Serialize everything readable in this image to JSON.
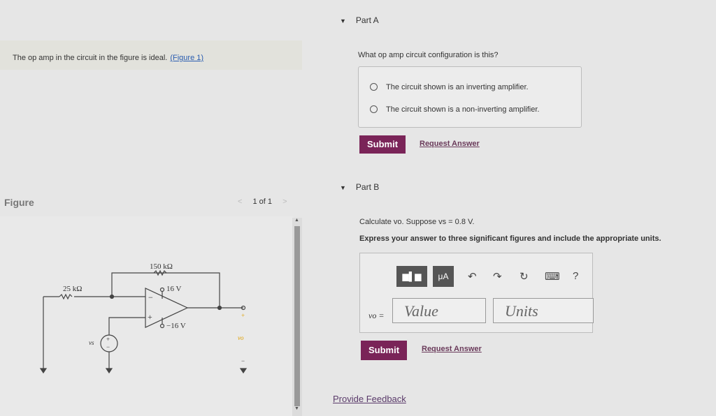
{
  "left": {
    "prompt": "The op amp in the circuit in the figure is ideal.",
    "figure_link": "(Figure 1)",
    "figure_title": "Figure",
    "figure_nav": {
      "prev": "<",
      "page": "1 of 1",
      "next": ">"
    }
  },
  "circuit": {
    "r_feedback": "150 kΩ",
    "r_input": "25 kΩ",
    "v_pos": "16 V",
    "v_neg": "−16 V",
    "source": "vs",
    "output": "vo",
    "plus": "+",
    "minus": "−",
    "inv": "−",
    "noninv": "+"
  },
  "partA": {
    "title": "Part A",
    "question": "What op amp circuit configuration is this?",
    "options": [
      "The circuit shown is an inverting amplifier.",
      "The circuit shown is a non-inverting amplifier."
    ],
    "submit": "Submit",
    "request": "Request Answer"
  },
  "partB": {
    "title": "Part B",
    "question": "Calculate vo. Suppose vs = 0.8  V.",
    "instructions": "Express your answer to three significant figures and include the appropriate units.",
    "toolbar": {
      "template_icon": "fraction-template-icon",
      "units_btn": "μA",
      "undo": "↶",
      "redo": "↷",
      "reset": "↻",
      "keyboard": "⌨",
      "help": "?"
    },
    "answer_label": "vo =",
    "value_placeholder": "Value",
    "units_placeholder": "Units",
    "submit": "Submit",
    "request": "Request Answer"
  },
  "feedback": "Provide Feedback",
  "colors": {
    "accent": "#7a2458",
    "link": "#2a5db0"
  }
}
